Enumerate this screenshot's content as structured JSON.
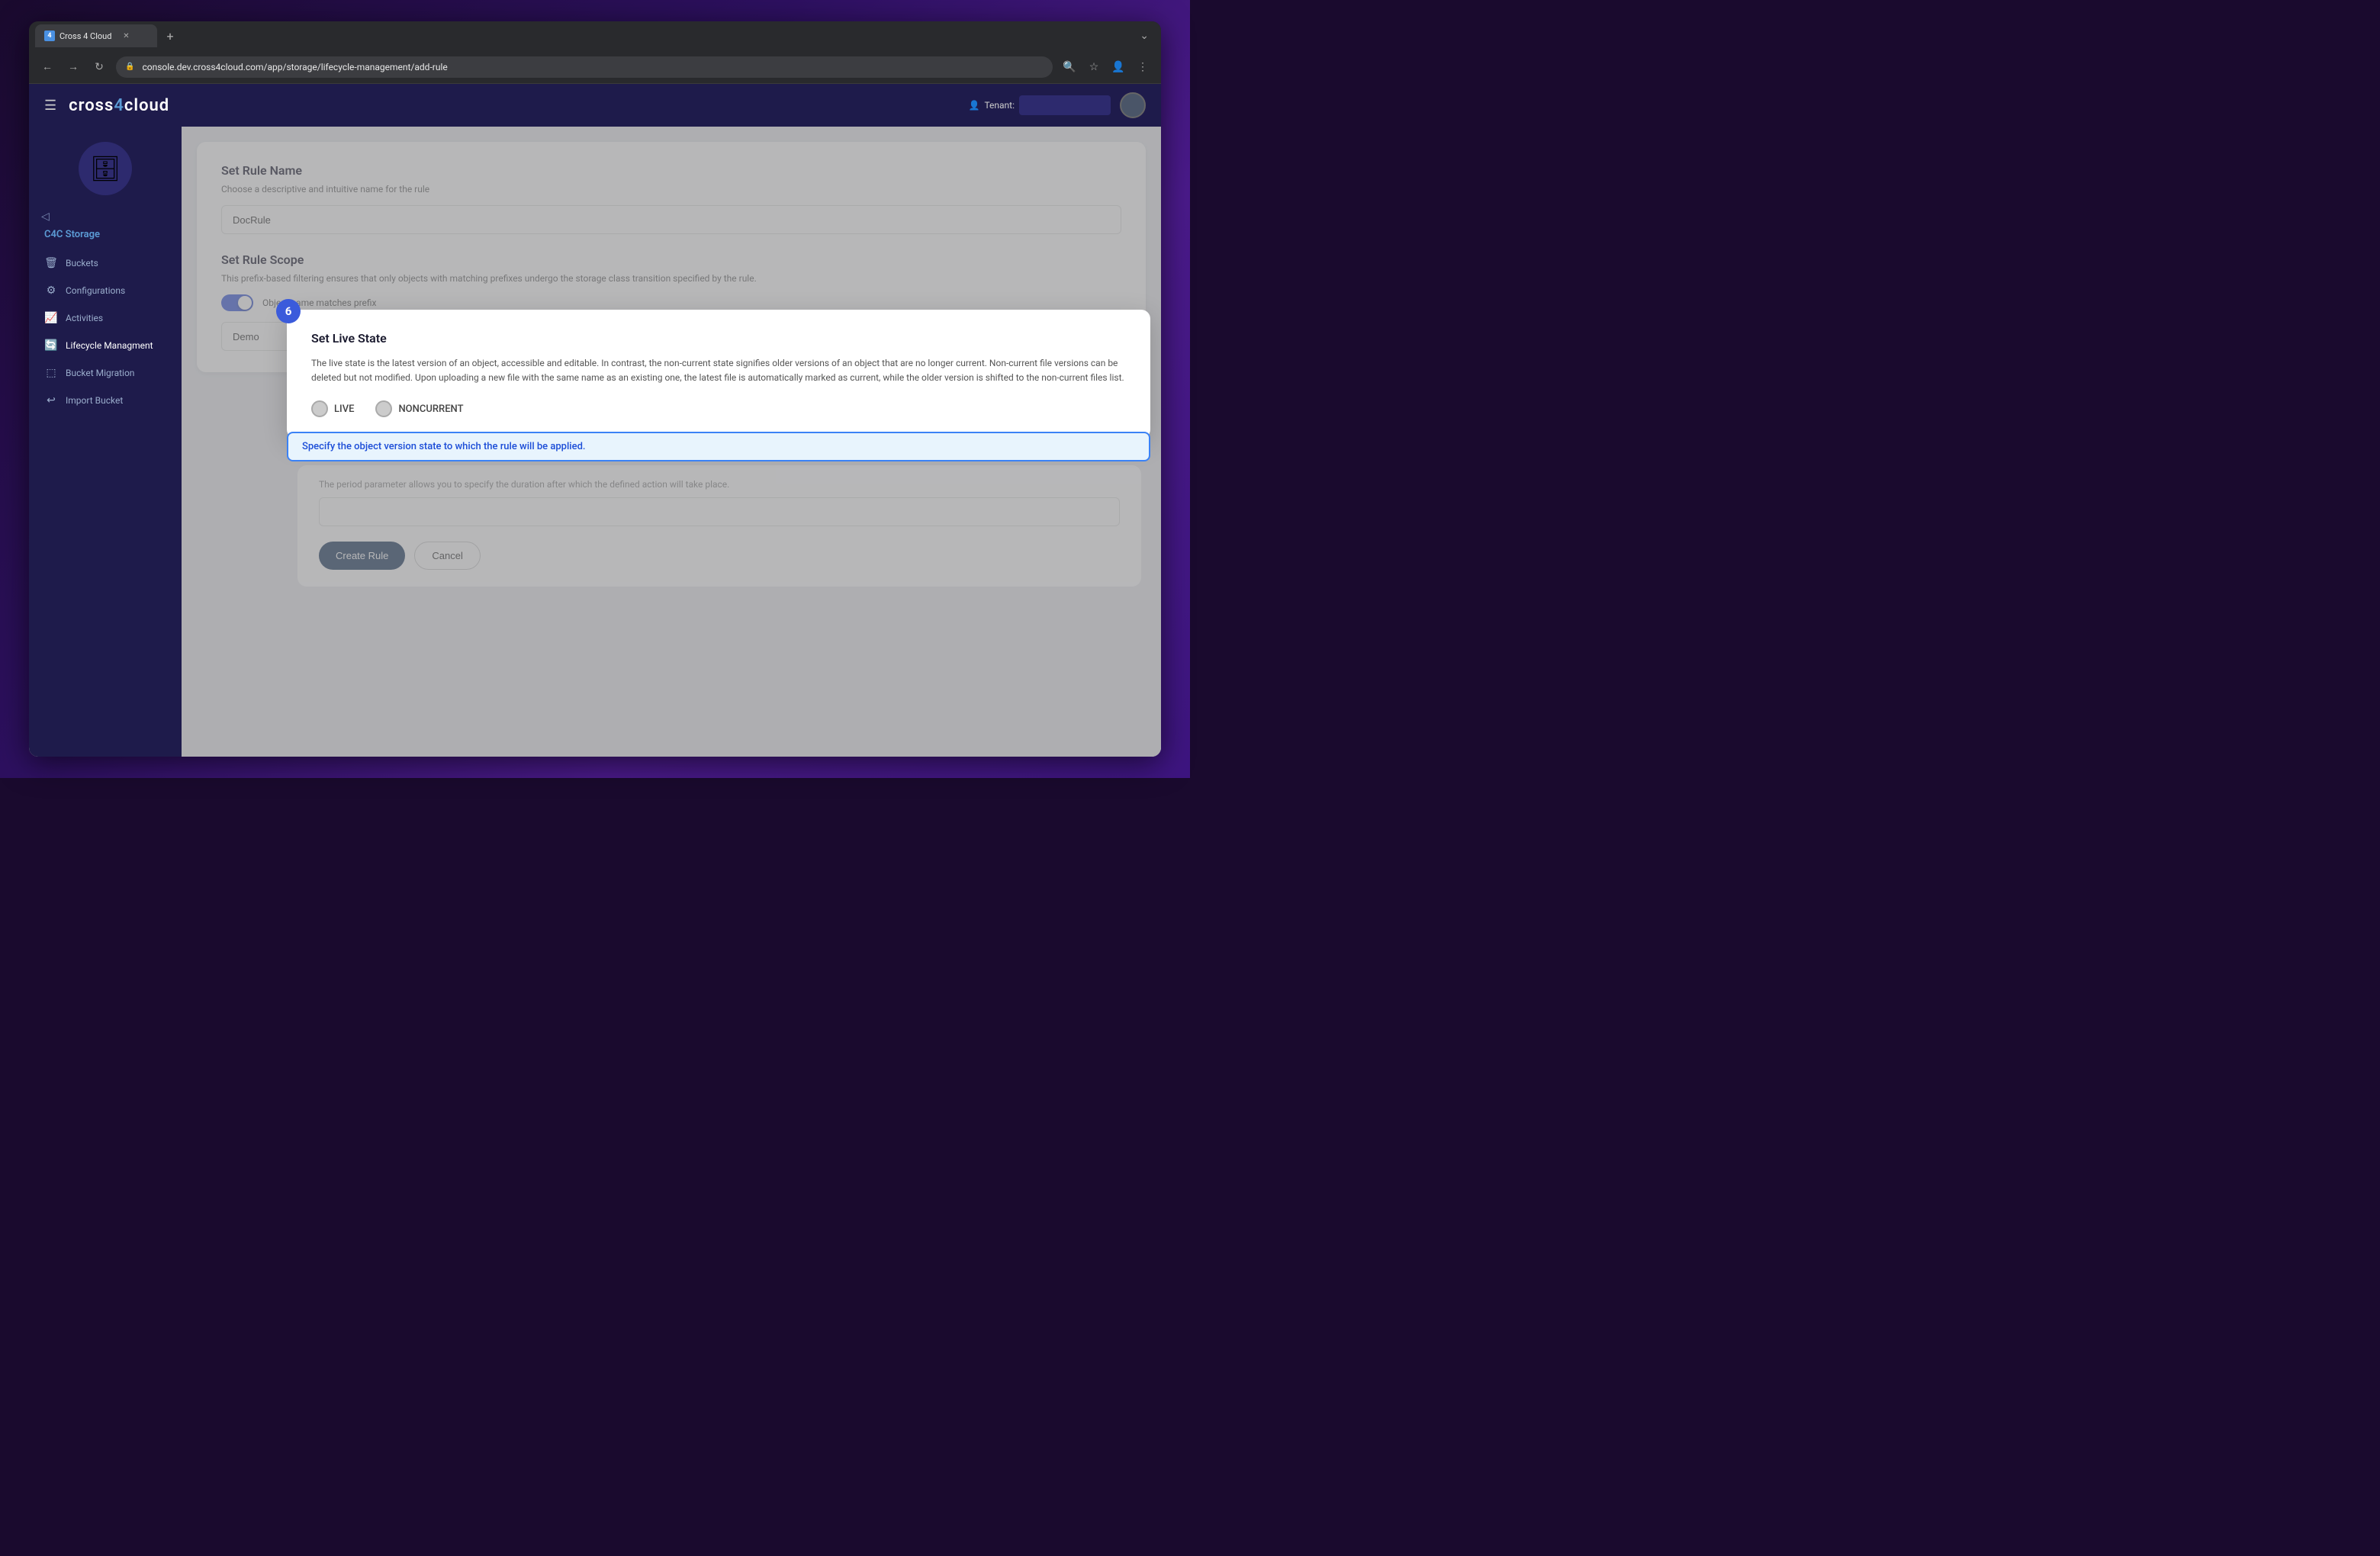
{
  "browser": {
    "tab_title": "Cross 4 Cloud",
    "tab_favicon": "4",
    "url": "console.dev.cross4cloud.com/app/storage/lifecycle-management/add-rule",
    "new_tab_icon": "+",
    "menu_icon": "⌄"
  },
  "nav": {
    "back": "←",
    "forward": "→",
    "refresh": "↻",
    "lock_icon": "🔒",
    "search_icon": "🔍",
    "star_icon": "☆",
    "profile_icon": "👤",
    "menu_icon": "⋮"
  },
  "header": {
    "hamburger": "☰",
    "logo_text": "cross",
    "logo_4": "4",
    "logo_cloud": "cloud",
    "tenant_label": "Tenant:",
    "user_icon": "👤"
  },
  "sidebar": {
    "collapse_icon": "◁",
    "section_title": "C4C Storage",
    "items": [
      {
        "label": "Buckets",
        "icon": "🗑"
      },
      {
        "label": "Configurations",
        "icon": "⚙"
      },
      {
        "label": "Activities",
        "icon": "📈"
      },
      {
        "label": "Lifecycle Managment",
        "icon": "🔄"
      },
      {
        "label": "Bucket Migration",
        "icon": "⬚"
      },
      {
        "label": "Import Bucket",
        "icon": "↩"
      }
    ]
  },
  "form": {
    "set_rule_name": {
      "title": "Set Rule Name",
      "description": "Choose a descriptive and intuitive name for the rule",
      "value": "DocRule",
      "placeholder": "DocRule"
    },
    "set_rule_scope": {
      "title": "Set Rule Scope",
      "description": "This prefix-based filtering ensures that only objects with matching prefixes undergo the storage class transition specified by the rule.",
      "toggle_label": "Object name matches prefix",
      "prefix_value": "Demo",
      "prefix_placeholder": "Demo"
    },
    "set_live_state": {
      "step_number": "6",
      "title": "Set Live State",
      "description": "The live state is the latest version of an object, accessible and editable. In contrast, the non-current state signifies older versions of an object that are no longer current. Non-current file versions can be deleted but not modified. Upon uploading a new file with the same name as an existing one, the latest file is automatically marked as current, while the older version is shifted to the non-current files list.",
      "radio_options": [
        {
          "label": "LIVE",
          "selected": false
        },
        {
          "label": "NONCURRENT",
          "selected": false
        }
      ]
    },
    "tooltip": {
      "text": "Specify the object version state to which the rule will be applied."
    },
    "period": {
      "description": "The period parameter allows you to specify the duration after which the defined action will take place."
    },
    "buttons": {
      "create": "Create Rule",
      "cancel": "Cancel"
    }
  },
  "colors": {
    "primary": "#3b5bdb",
    "sidebar_bg": "#1e1b4b",
    "toggle_active": "#3b5bdb",
    "tooltip_border": "#3b82f6",
    "tooltip_bg": "#e8f4fd",
    "tooltip_text": "#1d4ed8",
    "btn_primary_bg": "#1e3a5f"
  }
}
